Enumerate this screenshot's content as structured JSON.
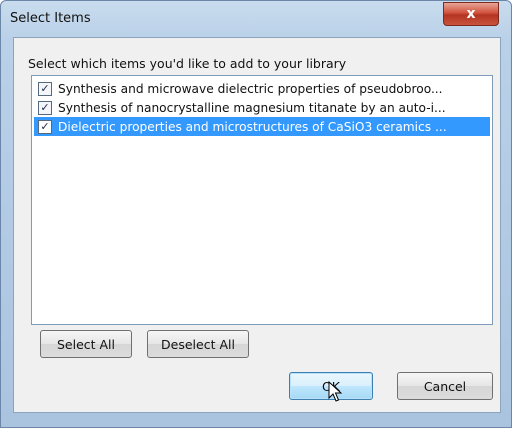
{
  "window": {
    "title": "Select Items",
    "close_label": "x"
  },
  "prompt": "Select which items you'd like to add to your library",
  "items": [
    {
      "label": "Synthesis and microwave dielectric properties of pseudobroo...",
      "checked": true,
      "selected": false
    },
    {
      "label": "Synthesis of nanocrystalline magnesium titanate by an auto-i...",
      "checked": true,
      "selected": false
    },
    {
      "label": "Dielectric properties and microstructures of CaSiO3 ceramics ...",
      "checked": true,
      "selected": true
    }
  ],
  "buttons": {
    "select_all": "Select All",
    "deselect_all": "Deselect All",
    "ok": "OK",
    "cancel": "Cancel"
  },
  "icons": {
    "check": "checkmark-icon",
    "cursor": "mouse-pointer-icon"
  },
  "colors": {
    "selection": "#3399ff",
    "titlebar": "#b9d0e8",
    "close": "#c8533c"
  }
}
